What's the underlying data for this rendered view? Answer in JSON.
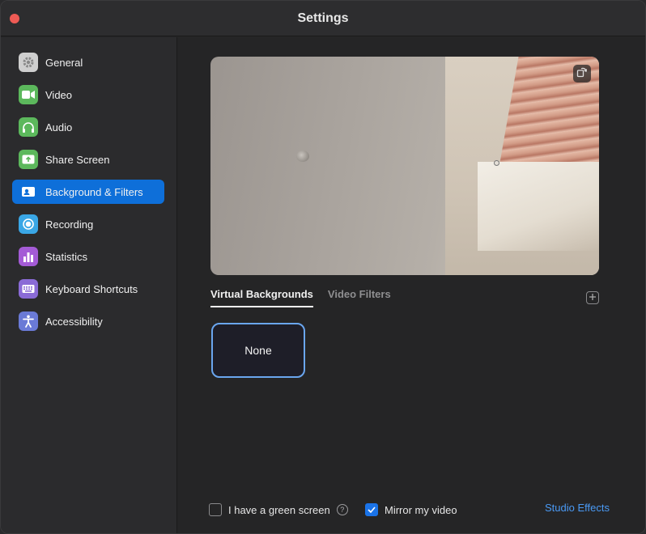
{
  "window": {
    "title": "Settings"
  },
  "sidebar": {
    "items": [
      {
        "label": "General",
        "icon": "gear-icon",
        "color": "#c8c8c8",
        "active": false
      },
      {
        "label": "Video",
        "icon": "video-camera-icon",
        "color": "#5cb85c",
        "active": false
      },
      {
        "label": "Audio",
        "icon": "headphones-icon",
        "color": "#5cb85c",
        "active": false
      },
      {
        "label": "Share Screen",
        "icon": "share-screen-icon",
        "color": "#5cb85c",
        "active": false
      },
      {
        "label": "Background & Filters",
        "icon": "person-card-icon",
        "color": "#0e6fd9",
        "active": true
      },
      {
        "label": "Recording",
        "icon": "record-icon",
        "color": "#3aa7e6",
        "active": false
      },
      {
        "label": "Statistics",
        "icon": "bar-chart-icon",
        "color": "#a45bd6",
        "active": false
      },
      {
        "label": "Keyboard Shortcuts",
        "icon": "keyboard-icon",
        "color": "#8a6bd6",
        "active": false
      },
      {
        "label": "Accessibility",
        "icon": "accessibility-icon",
        "color": "#6a7ad6",
        "active": false
      }
    ]
  },
  "main": {
    "tabs": [
      {
        "label": "Virtual Backgrounds",
        "active": true
      },
      {
        "label": "Video Filters",
        "active": false
      }
    ],
    "backgrounds": [
      {
        "label": "None",
        "selected": true
      }
    ],
    "green_screen": {
      "label": "I have a green screen",
      "checked": false
    },
    "mirror": {
      "label": "Mirror my video",
      "checked": true
    },
    "studio_effects": "Studio Effects"
  },
  "colors": {
    "accent": "#0e6fd9",
    "link": "#4a9af5",
    "close": "#ee5b55"
  }
}
